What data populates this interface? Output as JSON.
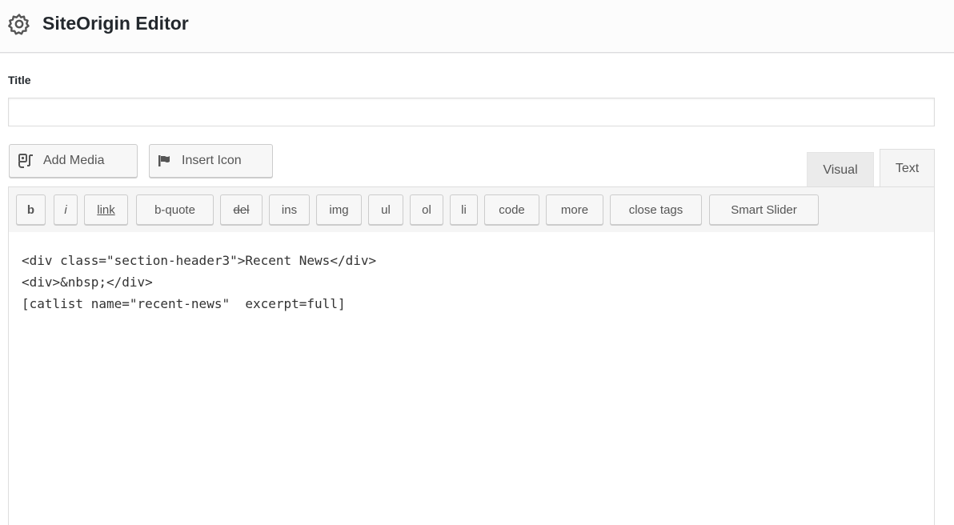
{
  "header": {
    "title": "SiteOrigin Editor",
    "icon": "gear-icon"
  },
  "form": {
    "title_label": "Title",
    "title_value": "",
    "title_placeholder": ""
  },
  "media_buttons": {
    "add_media": {
      "label": "Add Media",
      "icon": "add-media-icon"
    },
    "insert_icon": {
      "label": "Insert Icon",
      "icon": "flag-icon"
    }
  },
  "tabs": {
    "visual": "Visual",
    "text": "Text",
    "active": "text"
  },
  "quicktags": [
    {
      "label": "b"
    },
    {
      "label": "i"
    },
    {
      "label": "link"
    },
    {
      "label": "b-quote"
    },
    {
      "label": "del"
    },
    {
      "label": "ins"
    },
    {
      "label": "img"
    },
    {
      "label": "ul"
    },
    {
      "label": "ol"
    },
    {
      "label": "li"
    },
    {
      "label": "code"
    },
    {
      "label": "more"
    },
    {
      "label": "close tags"
    },
    {
      "label": "Smart Slider"
    }
  ],
  "editor": {
    "lines": [
      "<div class=\"section-header3\">Recent News</div>",
      "<div>&nbsp;</div>",
      "[catlist name=\"recent-news\"  excerpt=full]"
    ]
  },
  "colors": {
    "background": "#ffffff",
    "header_bg": "#fcfcfc",
    "toolbar_bg": "#f5f5f5",
    "button_bg": "#f7f7f7",
    "text": "#23282d",
    "button_text": "#555555"
  }
}
